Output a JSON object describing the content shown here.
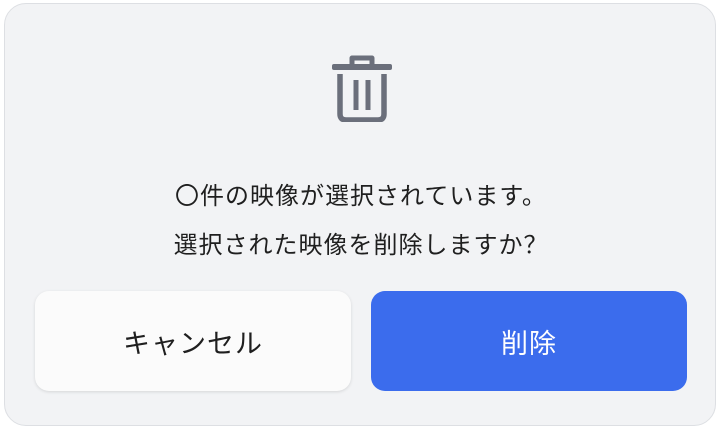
{
  "dialog": {
    "icon": "trash-icon",
    "message_line1": "〇件の映像が選択されています。",
    "message_line2": "選択された映像を削除しますか？",
    "cancel_label": "キャンセル",
    "delete_label": "削除"
  },
  "colors": {
    "background": "#f2f3f5",
    "icon": "#6b6f7b",
    "primary": "#3b6ced",
    "cancel_bg": "#fbfbfb",
    "text": "#1f1f1f"
  }
}
